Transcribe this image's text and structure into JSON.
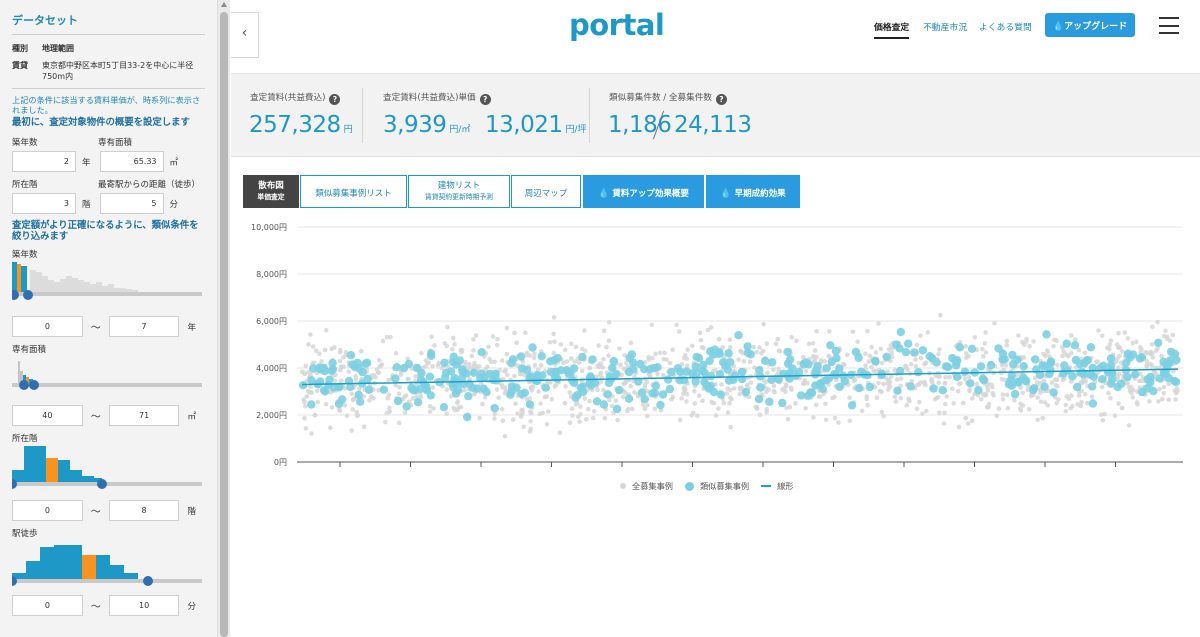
{
  "sidebar": {
    "title": "データセット",
    "kind_label": "種別",
    "kind_value": "地理範囲",
    "rent_label": "賃貸",
    "rent_value": "東京都中野区本町5丁目33-2を中心に半径750m内",
    "note": "上記の条件に該当する賃料単価が、時系列に表示されました。",
    "section1": "最初に、査定対象物件の概要を設定します",
    "age_label": "築年数",
    "area_label": "専有面積",
    "age_value": "2",
    "age_unit": "年",
    "area_value": "65.33",
    "area_unit": "㎡",
    "floor_label": "所在階",
    "walk_label": "最寄駅からの距離（徒歩）",
    "floor_value": "3",
    "floor_unit": "階",
    "walk_value": "5",
    "walk_unit": "分",
    "section2": "査定額がより正確になるように、類似条件を絞り込みます",
    "filters": [
      {
        "label": "築年数",
        "min": "0",
        "max": "7",
        "unit": "年"
      },
      {
        "label": "専有面積",
        "min": "40",
        "max": "71",
        "unit": "㎡"
      },
      {
        "label": "所在階",
        "min": "0",
        "max": "8",
        "unit": "階"
      },
      {
        "label": "駅徒歩",
        "min": "0",
        "max": "10",
        "unit": "分"
      }
    ],
    "tilde": "〜"
  },
  "header": {
    "logo": "portal",
    "nav": [
      "価格査定",
      "不動産市況",
      "よくある質問"
    ],
    "upgrade": "アップグレード",
    "collapse_icon": "‹"
  },
  "stats": {
    "rent_label": "査定賃料(共益費込)",
    "rent_value": "257,328",
    "rent_unit": "円",
    "unit_label": "査定賃料(共益費込)単価",
    "unit_value_m2": "3,939",
    "unit_m2": "円/㎡",
    "unit_value_tsubo": "13,021",
    "unit_tsubo": "円/坪",
    "count_label": "類似募集件数 / 全募集件数",
    "count_similar": "1,186",
    "count_total": "24,113",
    "help_icon": "?"
  },
  "tabs": [
    {
      "label": "散布図",
      "sub": "単価査定",
      "state": "active"
    },
    {
      "label": "類似募集事例リスト",
      "sub": ""
    },
    {
      "label": "建物リスト",
      "sub": "賃貸契約更新時期予測"
    },
    {
      "label": "周辺マップ",
      "sub": ""
    },
    {
      "label": "賃料アップ効果概要",
      "sub": "",
      "icon": "drop-icon"
    },
    {
      "label": "早期成約効果",
      "sub": "",
      "icon": "drop-icon"
    }
  ],
  "chart_data": {
    "type": "scatter",
    "yticks": [
      "10,000円",
      "8,000円",
      "6,000円",
      "4,000円",
      "2,000円",
      "0円"
    ],
    "ylim": [
      0,
      10000
    ],
    "series": [
      {
        "name": "全募集事例",
        "color": "#d6d6d6",
        "count": 24113,
        "mean": 3700,
        "spread": 900
      },
      {
        "name": "類似募集事例",
        "color": "#7ccfe2",
        "count": 1186,
        "mean": 3700,
        "spread": 600
      },
      {
        "name": "線形",
        "color": "#1aa0c8",
        "line": [
          3300,
          3950
        ]
      }
    ],
    "legend_position": "bottom",
    "grid": true
  }
}
